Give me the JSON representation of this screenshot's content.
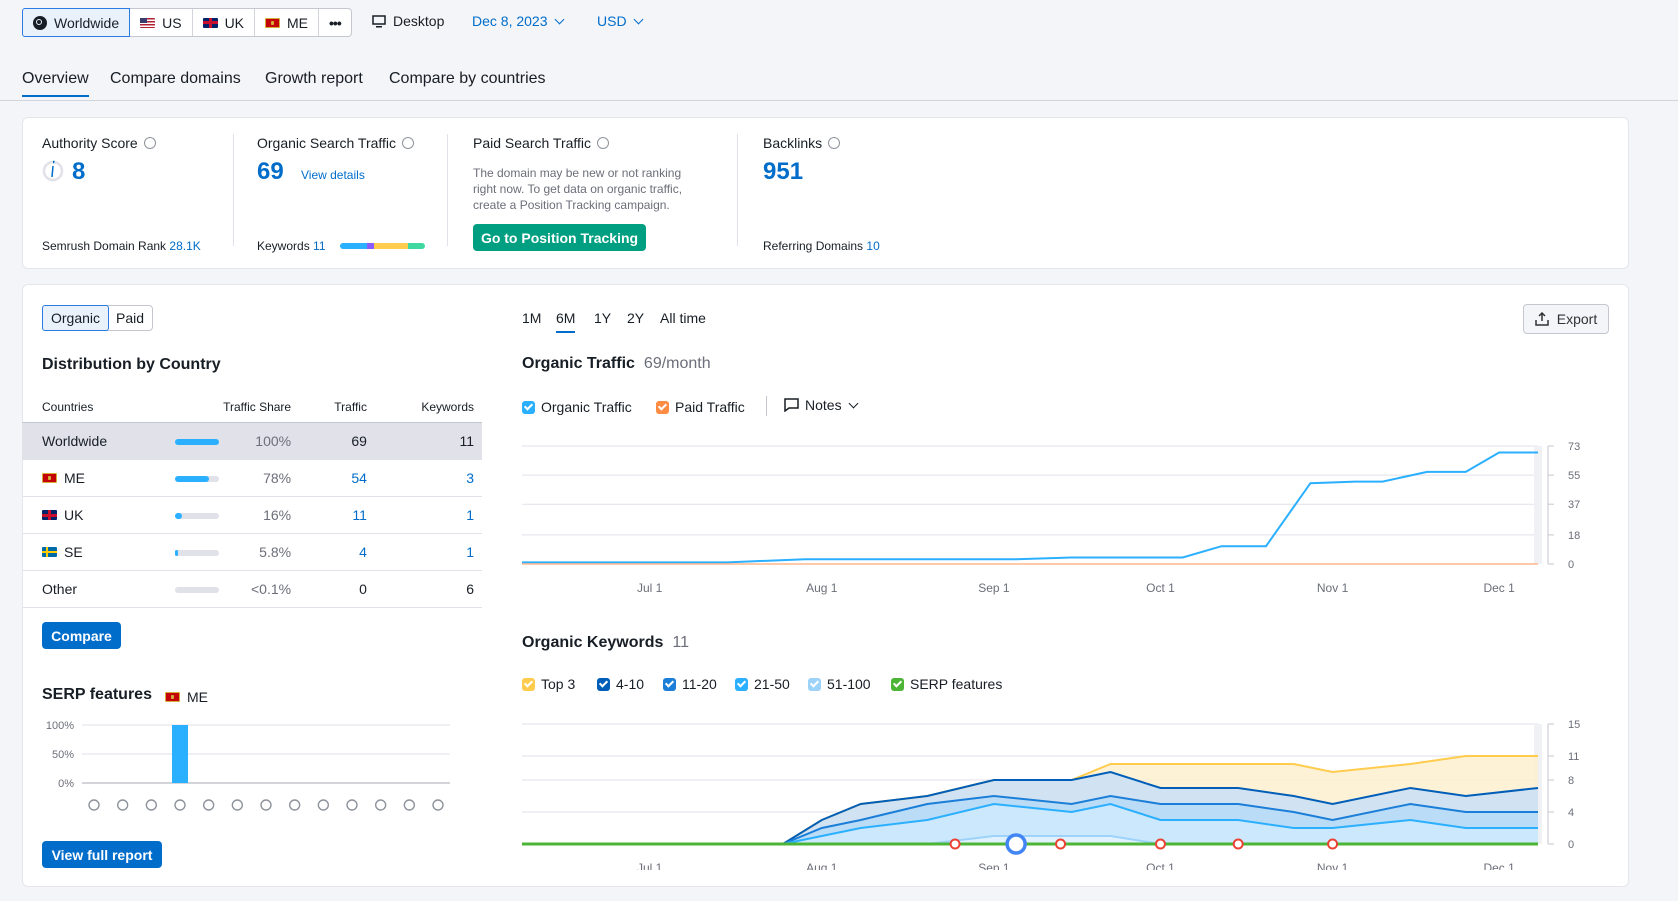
{
  "topbar": {
    "databases": [
      {
        "label": "Worldwide",
        "flag": "globe",
        "active": true
      },
      {
        "label": "US",
        "flag": "us"
      },
      {
        "label": "UK",
        "flag": "uk"
      },
      {
        "label": "ME",
        "flag": "me"
      }
    ],
    "more_label": "•••",
    "device": "Desktop",
    "date": "Dec 8, 2023",
    "currency": "USD"
  },
  "tabs": [
    "Overview",
    "Compare domains",
    "Growth report",
    "Compare by countries"
  ],
  "metrics": {
    "authority": {
      "title": "Authority Score",
      "value": "8",
      "footer_label": "Semrush Domain Rank",
      "footer_value": "28.1K"
    },
    "organic": {
      "title": "Organic Search Traffic",
      "value": "69",
      "link": "View details",
      "footer_label": "Keywords",
      "footer_value": "11"
    },
    "paid": {
      "title": "Paid Search Traffic",
      "note_lines": [
        "The domain may be new or not ranking",
        "right now. To get data on organic traffic,",
        "create a Position Tracking campaign."
      ],
      "button": "Go to Position Tracking"
    },
    "backlinks": {
      "title": "Backlinks",
      "value": "951",
      "footer_label": "Referring Domains",
      "footer_value": "10"
    }
  },
  "left": {
    "toggle": [
      "Organic",
      "Paid"
    ],
    "dist_title": "Distribution by Country",
    "columns": [
      "Countries",
      "Traffic Share",
      "Traffic",
      "Keywords"
    ],
    "rows": [
      {
        "country": "Worldwide",
        "flag": "",
        "share": "100%",
        "share_frac": 1.0,
        "traffic": "69",
        "keywords": "11"
      },
      {
        "country": "ME",
        "flag": "me",
        "share": "78%",
        "share_frac": 0.78,
        "traffic": "54",
        "keywords": "3"
      },
      {
        "country": "UK",
        "flag": "uk",
        "share": "16%",
        "share_frac": 0.16,
        "traffic": "11",
        "keywords": "1"
      },
      {
        "country": "SE",
        "flag": "se",
        "share": "5.8%",
        "share_frac": 0.058,
        "traffic": "4",
        "keywords": "1"
      },
      {
        "country": "Other",
        "flag": "",
        "share": "<0.1%",
        "share_frac": 0.0,
        "traffic": "0",
        "keywords": "6"
      }
    ],
    "compare_button": "Compare",
    "serp_title": "SERP features",
    "serp_country": "ME",
    "serp_yticks": [
      "100%",
      "50%",
      "0%"
    ],
    "serp_values": [
      0,
      0,
      0,
      100,
      0,
      0,
      0,
      0,
      0,
      0,
      0,
      0,
      0
    ],
    "serp_icons": [
      "crown-icon",
      "link-icon",
      "star-icon",
      "image-icon",
      "image-pack-icon",
      "video-icon",
      "video-carousel-icon",
      "play-icon",
      "map-pin-icon",
      "graduation-cap-icon",
      "news-icon",
      "briefcase-icon",
      "x-icon"
    ],
    "full_report_button": "View full report"
  },
  "range_tabs": [
    "1M",
    "6M",
    "1Y",
    "2Y",
    "All time"
  ],
  "range_selected": "6M",
  "export_label": "Export",
  "traffic": {
    "title": "Organic Traffic",
    "subtitle": "69/month",
    "legend": [
      {
        "label": "Organic Traffic",
        "color": "#2bafff"
      },
      {
        "label": "Paid Traffic",
        "color": "#ff8c43"
      }
    ],
    "notes_label": "Notes"
  },
  "keywords": {
    "title": "Organic Keywords",
    "count": "11",
    "legend": [
      {
        "label": "Top 3",
        "color": "#ffcc4e"
      },
      {
        "label": "4-10",
        "color": "#005eb8"
      },
      {
        "label": "11-20",
        "color": "#1b7ed8"
      },
      {
        "label": "21-50",
        "color": "#2bafff"
      },
      {
        "label": "51-100",
        "color": "#9dd3fb"
      },
      {
        "label": "SERP features",
        "color": "#4cb535"
      }
    ]
  },
  "chart_data": [
    {
      "type": "line",
      "title": "Organic Traffic",
      "x_ticks": [
        "Jul 1",
        "Aug 1",
        "Sep 1",
        "Oct 1",
        "Nov 1",
        "Dec 1"
      ],
      "y_ticks": [
        0,
        18,
        37,
        55,
        73
      ],
      "ylim": [
        0,
        73
      ],
      "x": [
        "Jun 8",
        "Jul 15",
        "Jul 29",
        "Aug 10",
        "Aug 25",
        "Sep 5",
        "Sep 15",
        "Sep 30",
        "Oct 5",
        "Oct 12",
        "Oct 15",
        "Oct 20",
        "Oct 28",
        "Nov 5",
        "Nov 10",
        "Nov 18",
        "Nov 25",
        "Dec 1",
        "Dec 8"
      ],
      "series": [
        {
          "name": "Organic Traffic",
          "values": [
            1,
            1,
            3,
            3,
            3,
            3,
            4,
            4,
            4,
            11,
            11,
            11,
            50,
            51,
            51,
            57,
            57,
            69,
            69
          ]
        },
        {
          "name": "Paid Traffic",
          "values": [
            0,
            0,
            0,
            0,
            0,
            0,
            0,
            0,
            0,
            0,
            0,
            0,
            0,
            0,
            0,
            0,
            0,
            0,
            0
          ]
        }
      ]
    },
    {
      "type": "area",
      "title": "Organic Keywords",
      "x_ticks": [
        "Jul 1",
        "Aug 1",
        "Sep 1",
        "Oct 1",
        "Nov 1",
        "Dec 1"
      ],
      "y_ticks": [
        0,
        4,
        8,
        11,
        15
      ],
      "ylim": [
        0,
        15
      ],
      "x": [
        "Jun 8",
        "Jul 25",
        "Aug 1",
        "Aug 8",
        "Aug 20",
        "Sep 1",
        "Sep 15",
        "Sep 22",
        "Oct 1",
        "Oct 15",
        "Oct 25",
        "Nov 1",
        "Nov 15",
        "Nov 25",
        "Dec 8"
      ],
      "series": [
        {
          "name": "Top 3",
          "values": [
            0,
            0,
            3,
            5,
            6,
            8,
            8,
            10,
            10,
            10,
            10,
            9,
            10,
            11,
            11
          ]
        },
        {
          "name": "4-10",
          "values": [
            0,
            0,
            3,
            5,
            6,
            8,
            8,
            9,
            7,
            7,
            6,
            5,
            7,
            6,
            7
          ]
        },
        {
          "name": "11-20",
          "values": [
            0,
            0,
            2,
            3,
            5,
            6,
            5,
            6,
            5,
            5,
            4,
            3,
            5,
            4,
            4
          ]
        },
        {
          "name": "21-50",
          "values": [
            0,
            0,
            1,
            2,
            3,
            5,
            4,
            5,
            3,
            3,
            2,
            2,
            3,
            2,
            2
          ]
        },
        {
          "name": "51-100",
          "values": [
            0,
            0,
            0,
            0,
            0,
            1,
            1,
            1,
            0,
            0,
            0,
            0,
            0,
            0,
            0
          ]
        },
        {
          "name": "SERP features",
          "values": [
            0,
            0,
            0,
            0,
            0,
            0,
            0,
            0,
            0,
            0,
            0,
            0,
            0,
            0,
            0
          ]
        }
      ]
    }
  ]
}
